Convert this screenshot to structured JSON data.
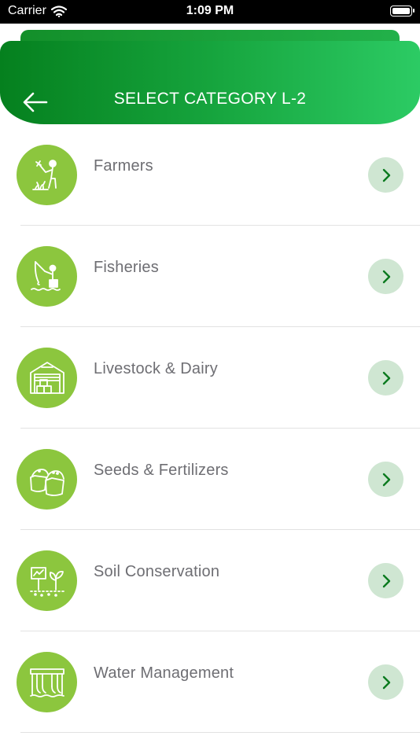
{
  "status_bar": {
    "carrier": "Carrier",
    "time": "1:09 PM"
  },
  "header": {
    "title": "SELECT CATEGORY L-2",
    "back_icon": "arrow-left-icon"
  },
  "colors": {
    "header_gradient_start": "#05801e",
    "header_gradient_end": "#2ccb64",
    "icon_circle": "#8cc63e",
    "chevron_bg": "#cfe6d2",
    "chevron_fg": "#0b7a1f"
  },
  "categories": [
    {
      "label": "Farmers",
      "icon": "farmer-icon"
    },
    {
      "label": "Fisheries",
      "icon": "fishing-icon"
    },
    {
      "label": "Livestock & Dairy",
      "icon": "barn-icon"
    },
    {
      "label": "Seeds & Fertilizers",
      "icon": "seed-sacks-icon"
    },
    {
      "label": "Soil Conservation",
      "icon": "soil-sprout-icon"
    },
    {
      "label": "Water Management",
      "icon": "water-dam-icon"
    }
  ]
}
